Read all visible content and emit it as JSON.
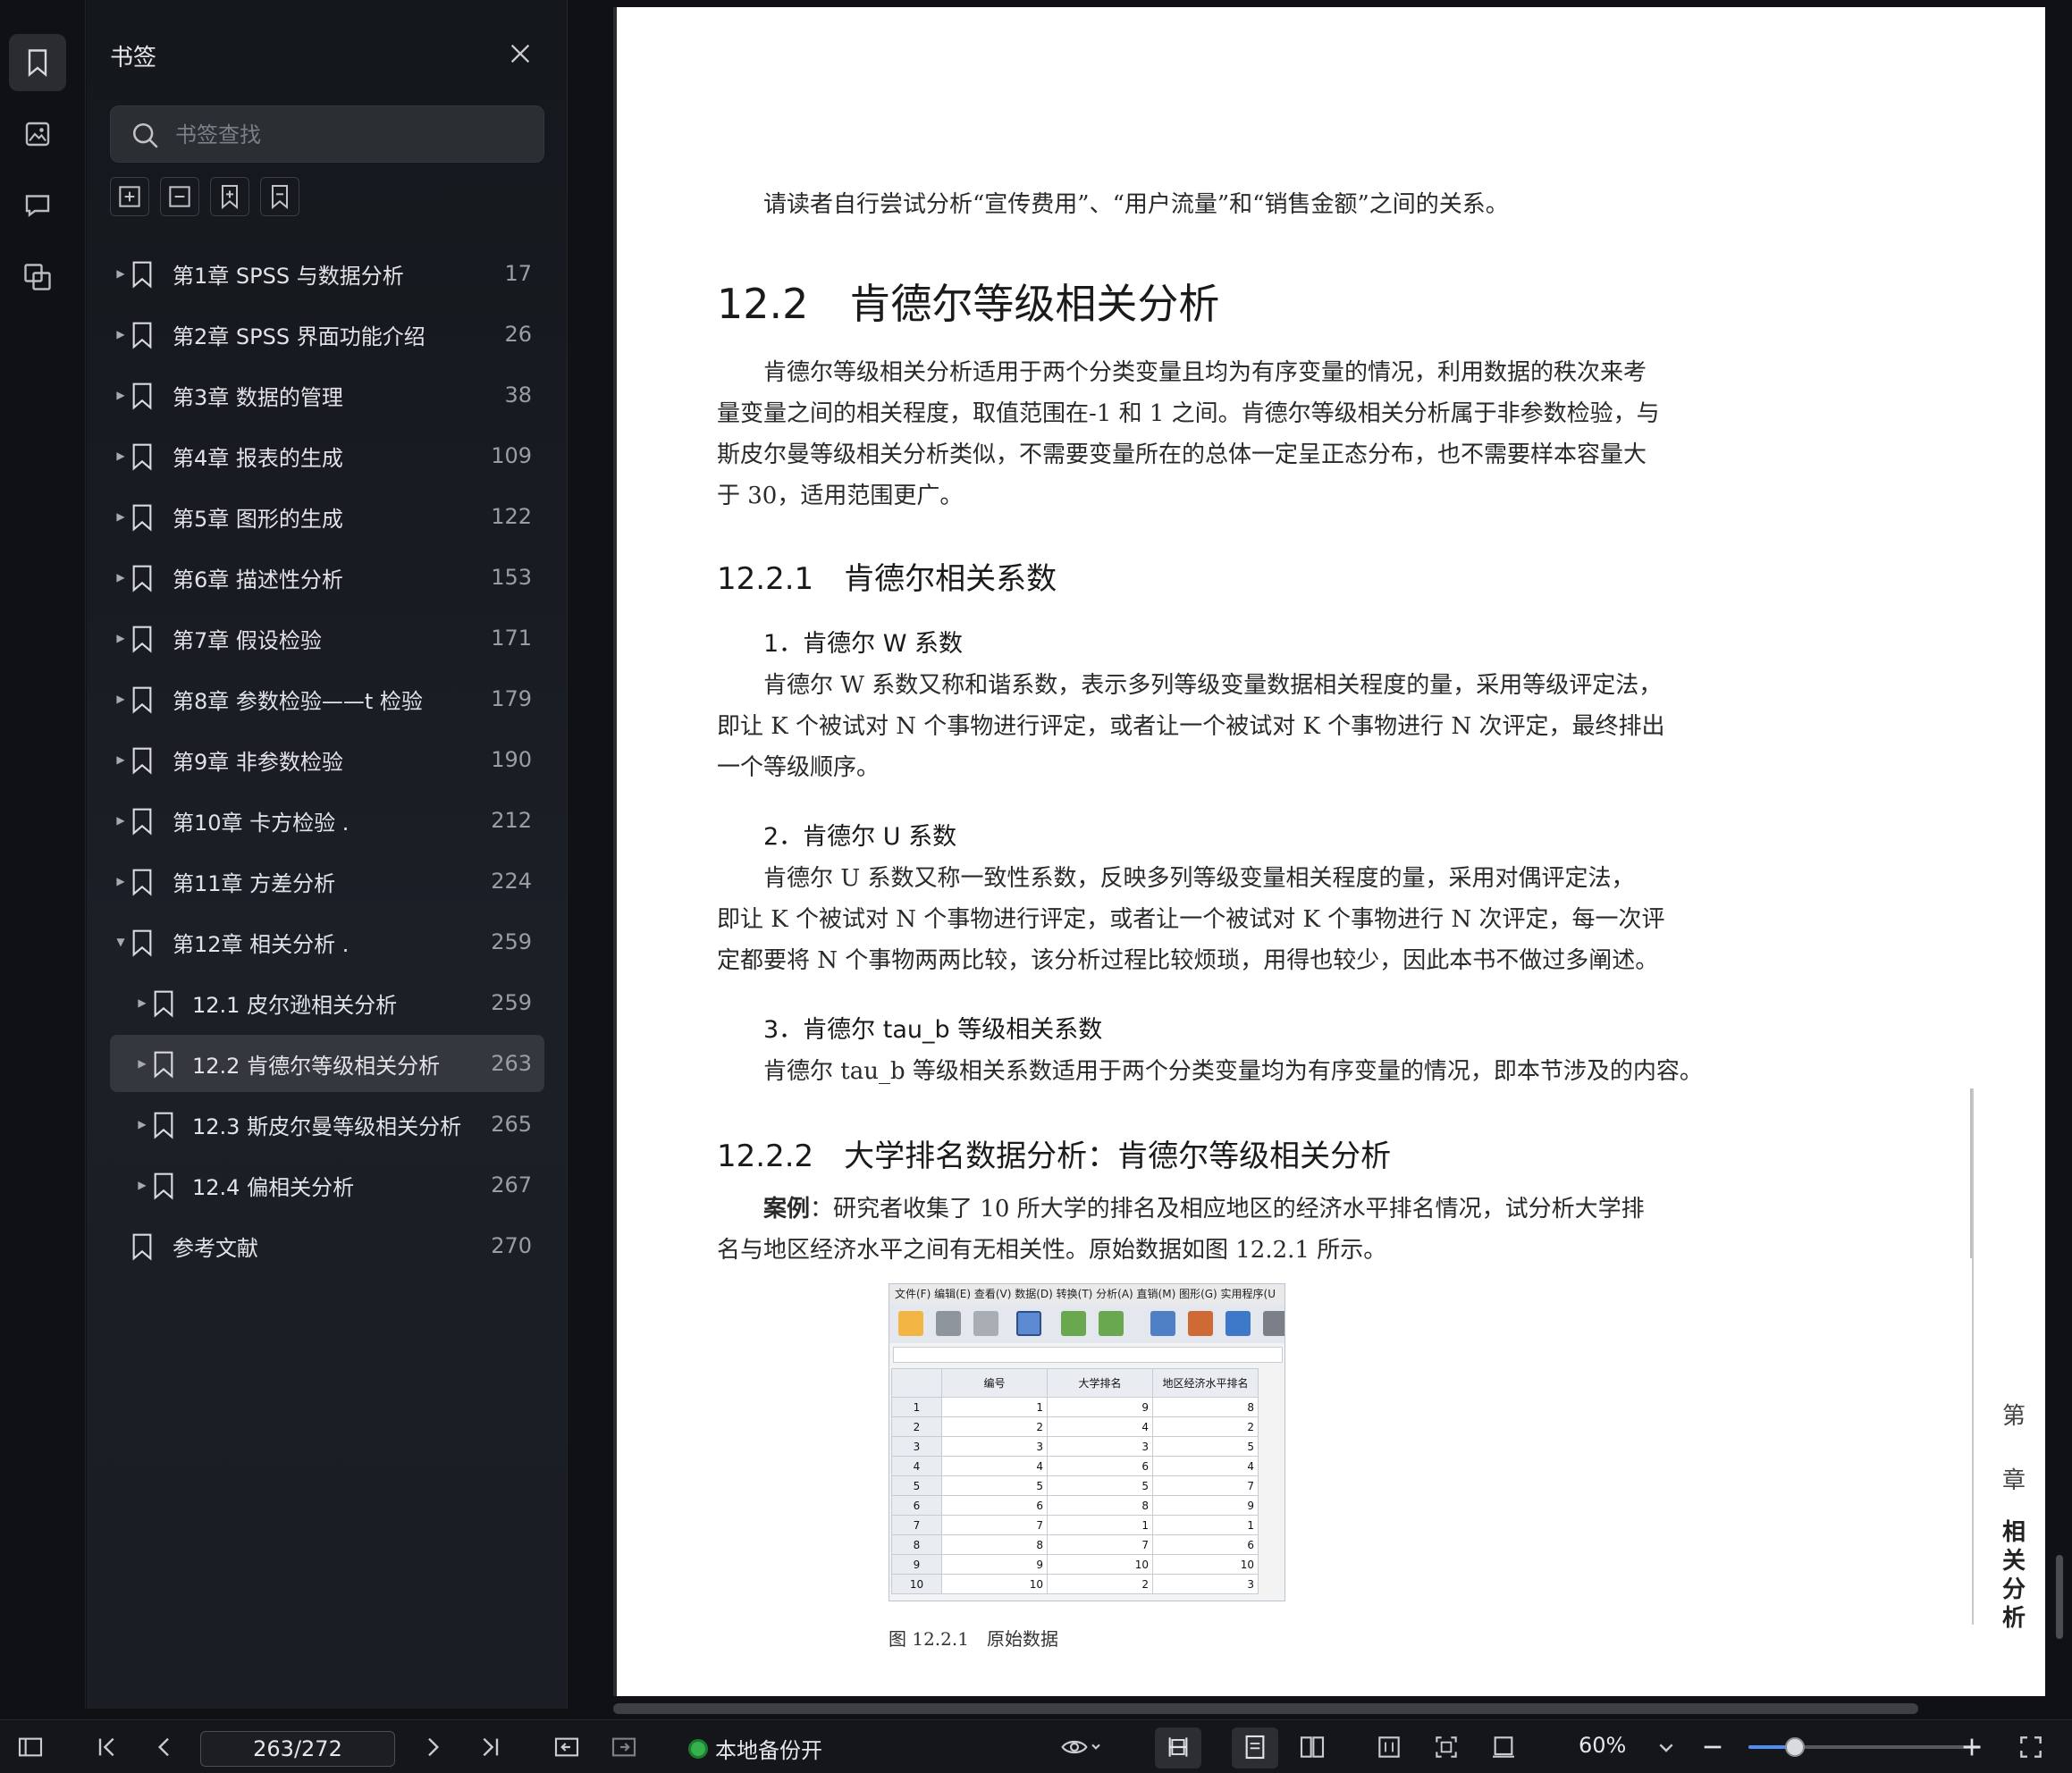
{
  "panel": {
    "title": "书签",
    "search_placeholder": "书签查找"
  },
  "bookmarks": [
    {
      "label": "第1章 SPSS 与数据分析",
      "page": "17",
      "expanded": false,
      "level": 1
    },
    {
      "label": "第2章 SPSS 界面功能介绍",
      "page": "26",
      "expanded": false,
      "level": 1
    },
    {
      "label": "第3章 数据的管理",
      "page": "38",
      "expanded": false,
      "level": 1
    },
    {
      "label": "第4章 报表的生成",
      "page": "109",
      "expanded": false,
      "level": 1
    },
    {
      "label": "第5章 图形的生成",
      "page": "122",
      "expanded": false,
      "level": 1
    },
    {
      "label": "第6章 描述性分析",
      "page": "153",
      "expanded": false,
      "level": 1
    },
    {
      "label": "第7章 假设检验",
      "page": "171",
      "expanded": false,
      "level": 1
    },
    {
      "label": "第8章 参数检验——t 检验",
      "page": "179",
      "expanded": false,
      "level": 1
    },
    {
      "label": "第9章 非参数检验",
      "page": "190",
      "expanded": false,
      "level": 1
    },
    {
      "label": "第10章 卡方检验 .",
      "page": "212",
      "expanded": false,
      "level": 1
    },
    {
      "label": "第11章 方差分析",
      "page": "224",
      "expanded": false,
      "level": 1
    },
    {
      "label": "第12章 相关分析 .",
      "page": "259",
      "expanded": true,
      "level": 1
    },
    {
      "label": "12.1 皮尔逊相关分析",
      "page": "259",
      "expanded": false,
      "level": 2
    },
    {
      "label": "12.2 肯德尔等级相关分析",
      "page": "263",
      "expanded": false,
      "level": 2,
      "active": true
    },
    {
      "label": "12.3 斯皮尔曼等级相关分析",
      "page": "265",
      "expanded": false,
      "level": 2
    },
    {
      "label": "12.4 偏相关分析",
      "page": "267",
      "expanded": false,
      "level": 2
    },
    {
      "label": "参考文献",
      "page": "270",
      "expanded": false,
      "level": 1,
      "no_arrow": true
    }
  ],
  "doc": {
    "intro": "请读者自行尝试分析“宣传费用”、“用户流量”和“销售金额”之间的关系。",
    "h2": "12.2　肯德尔等级相关分析",
    "para1": [
      "　　肯德尔等级相关分析适用于两个分类变量且均为有序变量的情况，利用数据的秩次来考",
      "量变量之间的相关程度，取值范围在-1 和 1 之间。肯德尔等级相关分析属于非参数检验，与",
      "斯皮尔曼等级相关分析类似，不需要变量所在的总体一定呈正态分布，也不需要样本容量大",
      "于 30，适用范围更广。"
    ],
    "h3a": "12.2.1　肯德尔相关系数",
    "h4a": "1．肯德尔 W 系数",
    "paraW": [
      "　　肯德尔  W  系数又称和谐系数，表示多列等级变量数据相关程度的量，采用等级评定法，",
      "即让 K 个被试对 N 个事物进行评定，或者让一个被试对 K 个事物进行 N 次评定，最终排出",
      "一个等级顺序。"
    ],
    "h4b": "2．肯德尔 U 系数",
    "paraU": [
      "　　肯德尔  U  系数又称一致性系数，反映多列等级变量相关程度的量，采用对偶评定法，",
      "即让 K 个被试对 N 个事物进行评定，或者让一个被试对 K 个事物进行 N 次评定，每一次评",
      "定都要将 N 个事物两两比较，该分析过程比较烦琐，用得也较少，因此本书不做过多阐述。"
    ],
    "h4c": "3．肯德尔 tau_b 等级相关系数",
    "paraTau": "　　肯德尔 tau_b 等级相关系数适用于两个分类变量均为有序变量的情况，即本节涉及的内容。",
    "h3b": "12.2.2　大学排名数据分析：肯德尔等级相关分析",
    "case_label": "案例",
    "para_case": [
      "：研究者收集了  10  所大学的排名及相应地区的经济水平排名情况，试分析大学排",
      "名与地区经济水平之间有无相关性。原始数据如图 12.2.1 所示。"
    ],
    "fig_caption": "图 12.2.1　原始数据",
    "side_tab": [
      "第",
      "章",
      "相",
      "关",
      "分",
      "析"
    ]
  },
  "figure": {
    "menu": "文件(F) 编辑(E) 查看(V) 数据(D) 转换(T) 分析(A) 直销(M) 图形(G) 实用程序(U",
    "columns": [
      "编号",
      "大学排名",
      "地区经济水平排名"
    ],
    "rows": [
      [
        1,
        9,
        8
      ],
      [
        2,
        4,
        2
      ],
      [
        3,
        3,
        5
      ],
      [
        4,
        6,
        4
      ],
      [
        5,
        5,
        7
      ],
      [
        6,
        8,
        9
      ],
      [
        7,
        1,
        1
      ],
      [
        8,
        7,
        6
      ],
      [
        9,
        10,
        10
      ],
      [
        10,
        2,
        3
      ]
    ]
  },
  "status": {
    "page_indicator": "263/272",
    "backup_label": "本地备份开",
    "zoom": "60%",
    "zoom_fraction": 0.2
  }
}
